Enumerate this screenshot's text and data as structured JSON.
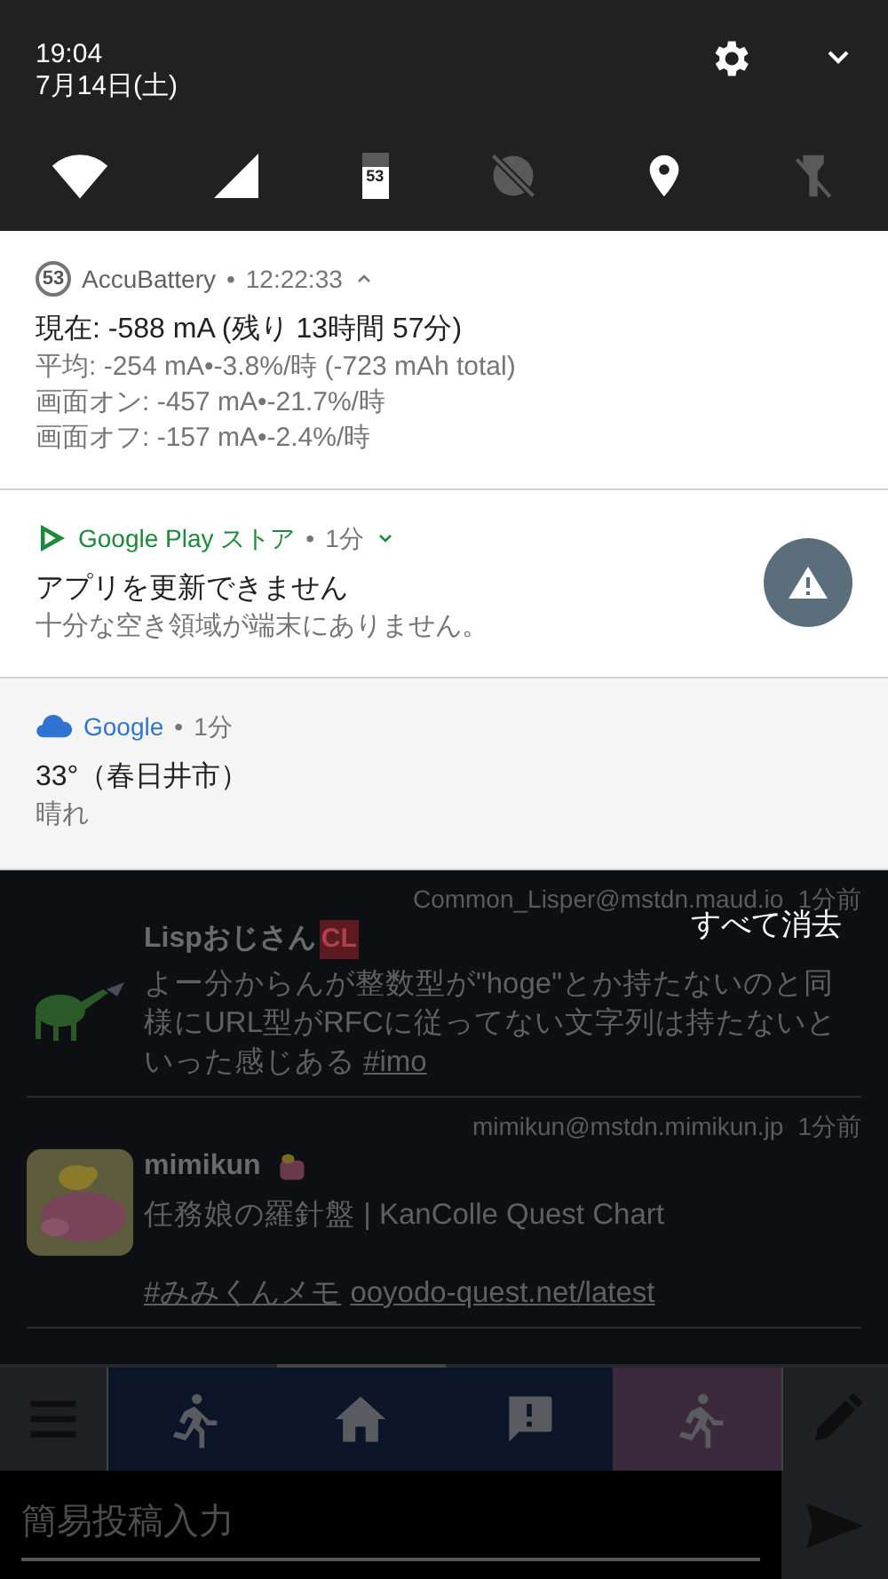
{
  "status": {
    "time": "19:04",
    "date": "7月14日(土)"
  },
  "quick_settings": [
    {
      "kind": "wifi",
      "on": true
    },
    {
      "kind": "signal",
      "on": true
    },
    {
      "kind": "battery",
      "on": true,
      "label": "53"
    },
    {
      "kind": "data_saver",
      "on": false
    },
    {
      "kind": "location",
      "on": true
    },
    {
      "kind": "flashlight",
      "on": false
    }
  ],
  "notifications": [
    {
      "kind": "battery",
      "app": "AccuBattery",
      "badge": "53",
      "separator": "•",
      "time": "12:22:33",
      "expanded": true,
      "title": "現在: -588 mA (残り 13時間 57分)",
      "lines": [
        "平均: -254 mA•-3.8%/時 (-723 mAh total)",
        "画面オン: -457 mA•-21.7%/時",
        "画面オフ: -157 mA•-2.4%/時"
      ]
    },
    {
      "kind": "play",
      "app": "Google Play ストア",
      "separator": "•",
      "time": "1分",
      "expanded": false,
      "title": "アプリを更新できません",
      "lines": [
        "十分な空き領域が端末にありません。"
      ]
    },
    {
      "kind": "weather",
      "app": "Google",
      "separator": "•",
      "time": "1分",
      "title": "33°（春日井市）",
      "lines": [
        "晴れ"
      ]
    }
  ],
  "clear_all": "すべて消去",
  "toots": [
    {
      "account": "Common_Lisper@mstdn.maud.io",
      "time": "1分前",
      "name": "Lispおじさん",
      "badge": "CL",
      "body": "よー分からんが整数型が\"hoge\"とか持たないのと同様にURL型がRFCに従ってない文字列は持たないといった感じある",
      "links": [
        "#imo"
      ]
    },
    {
      "account": "mimikun@mstdn.mimikun.jp",
      "time": "1分前",
      "name": "mimikun",
      "body": "任務娘の羅針盤 | KanColle Quest Chart",
      "links": [
        "#みみくんメモ",
        "ooyodo-quest.net/latest"
      ]
    }
  ],
  "columns": [
    {
      "kind": "run",
      "color": "#0c1428",
      "selected": false
    },
    {
      "kind": "home",
      "color": "#0c1428",
      "selected": true
    },
    {
      "kind": "notice",
      "color": "#0c1428",
      "selected": false
    },
    {
      "kind": "run",
      "color": "#3b2a3e",
      "selected": false
    }
  ],
  "compose": {
    "placeholder": "簡易投稿入力"
  }
}
